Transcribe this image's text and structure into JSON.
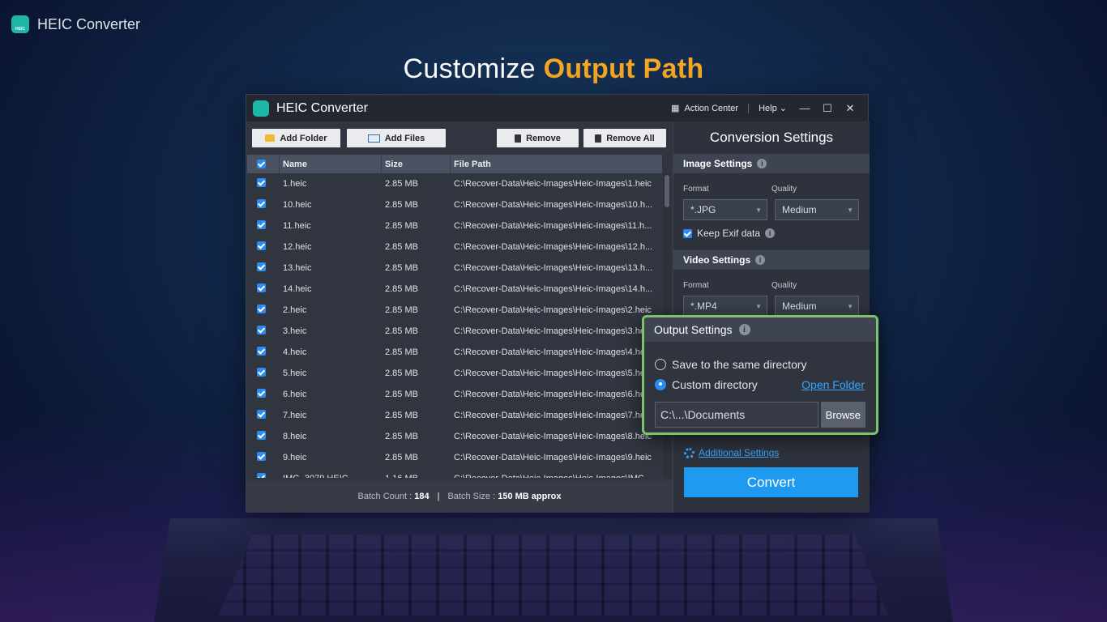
{
  "brand": {
    "title": "HEIC Converter",
    "logo_text": "HEIC"
  },
  "headline": {
    "prefix": "Customize",
    "accent": "Output Path"
  },
  "window": {
    "title": "HEIC Converter",
    "action_center": "Action Center",
    "help": "Help",
    "controls": [
      "minimize-icon",
      "maximize-icon",
      "close-icon"
    ]
  },
  "toolbar": {
    "add_folder": "Add Folder",
    "add_files": "Add Files",
    "remove": "Remove",
    "remove_all": "Remove All"
  },
  "table": {
    "columns": [
      "Name",
      "Size",
      "File Path"
    ],
    "rows": [
      {
        "name": "1.heic",
        "size": "2.85 MB",
        "path": "C:\\Recover-Data\\Heic-Images\\Heic-Images\\1.heic"
      },
      {
        "name": "10.heic",
        "size": "2.85 MB",
        "path": "C:\\Recover-Data\\Heic-Images\\Heic-Images\\10.h..."
      },
      {
        "name": "11.heic",
        "size": "2.85 MB",
        "path": "C:\\Recover-Data\\Heic-Images\\Heic-Images\\11.h..."
      },
      {
        "name": "12.heic",
        "size": "2.85 MB",
        "path": "C:\\Recover-Data\\Heic-Images\\Heic-Images\\12.h..."
      },
      {
        "name": "13.heic",
        "size": "2.85 MB",
        "path": "C:\\Recover-Data\\Heic-Images\\Heic-Images\\13.h..."
      },
      {
        "name": "14.heic",
        "size": "2.85 MB",
        "path": "C:\\Recover-Data\\Heic-Images\\Heic-Images\\14.h..."
      },
      {
        "name": "2.heic",
        "size": "2.85 MB",
        "path": "C:\\Recover-Data\\Heic-Images\\Heic-Images\\2.heic"
      },
      {
        "name": "3.heic",
        "size": "2.85 MB",
        "path": "C:\\Recover-Data\\Heic-Images\\Heic-Images\\3.heic"
      },
      {
        "name": "4.heic",
        "size": "2.85 MB",
        "path": "C:\\Recover-Data\\Heic-Images\\Heic-Images\\4.heic"
      },
      {
        "name": "5.heic",
        "size": "2.85 MB",
        "path": "C:\\Recover-Data\\Heic-Images\\Heic-Images\\5.heic"
      },
      {
        "name": "6.heic",
        "size": "2.85 MB",
        "path": "C:\\Recover-Data\\Heic-Images\\Heic-Images\\6.heic"
      },
      {
        "name": "7.heic",
        "size": "2.85 MB",
        "path": "C:\\Recover-Data\\Heic-Images\\Heic-Images\\7.heic"
      },
      {
        "name": "8.heic",
        "size": "2.85 MB",
        "path": "C:\\Recover-Data\\Heic-Images\\Heic-Images\\8.heic"
      },
      {
        "name": "9.heic",
        "size": "2.85 MB",
        "path": "C:\\Recover-Data\\Heic-Images\\Heic-Images\\9.heic"
      },
      {
        "name": "IMG_3079.HEIC",
        "size": "1.16 MB",
        "path": "C:\\Recover-Data\\Heic-Images\\Heic-Images\\IMG..."
      }
    ]
  },
  "footer": {
    "batch_count_label": "Batch Count :",
    "batch_count": "184",
    "separator": "|",
    "batch_size_label": "Batch Size :",
    "batch_size": "150 MB approx"
  },
  "settings": {
    "title": "Conversion Settings",
    "image": {
      "heading": "Image Settings",
      "format_label": "Format",
      "quality_label": "Quality",
      "format": "*.JPG",
      "quality": "Medium",
      "keep_exif": "Keep Exif data"
    },
    "video": {
      "heading": "Video Settings",
      "format_label": "Format",
      "quality_label": "Quality",
      "format": "*.MP4",
      "quality": "Medium"
    },
    "additional": "Additional Settings",
    "convert": "Convert"
  },
  "output": {
    "heading": "Output Settings",
    "option_same": "Save to the same directory",
    "option_custom": "Custom directory",
    "open_folder": "Open Folder",
    "directory": "C:\\...\\Documents",
    "browse": "Browse",
    "selected": "custom"
  },
  "colors": {
    "accent": "#f7a823",
    "primary": "#1e9bf0",
    "highlight_border": "#7dc26a"
  }
}
